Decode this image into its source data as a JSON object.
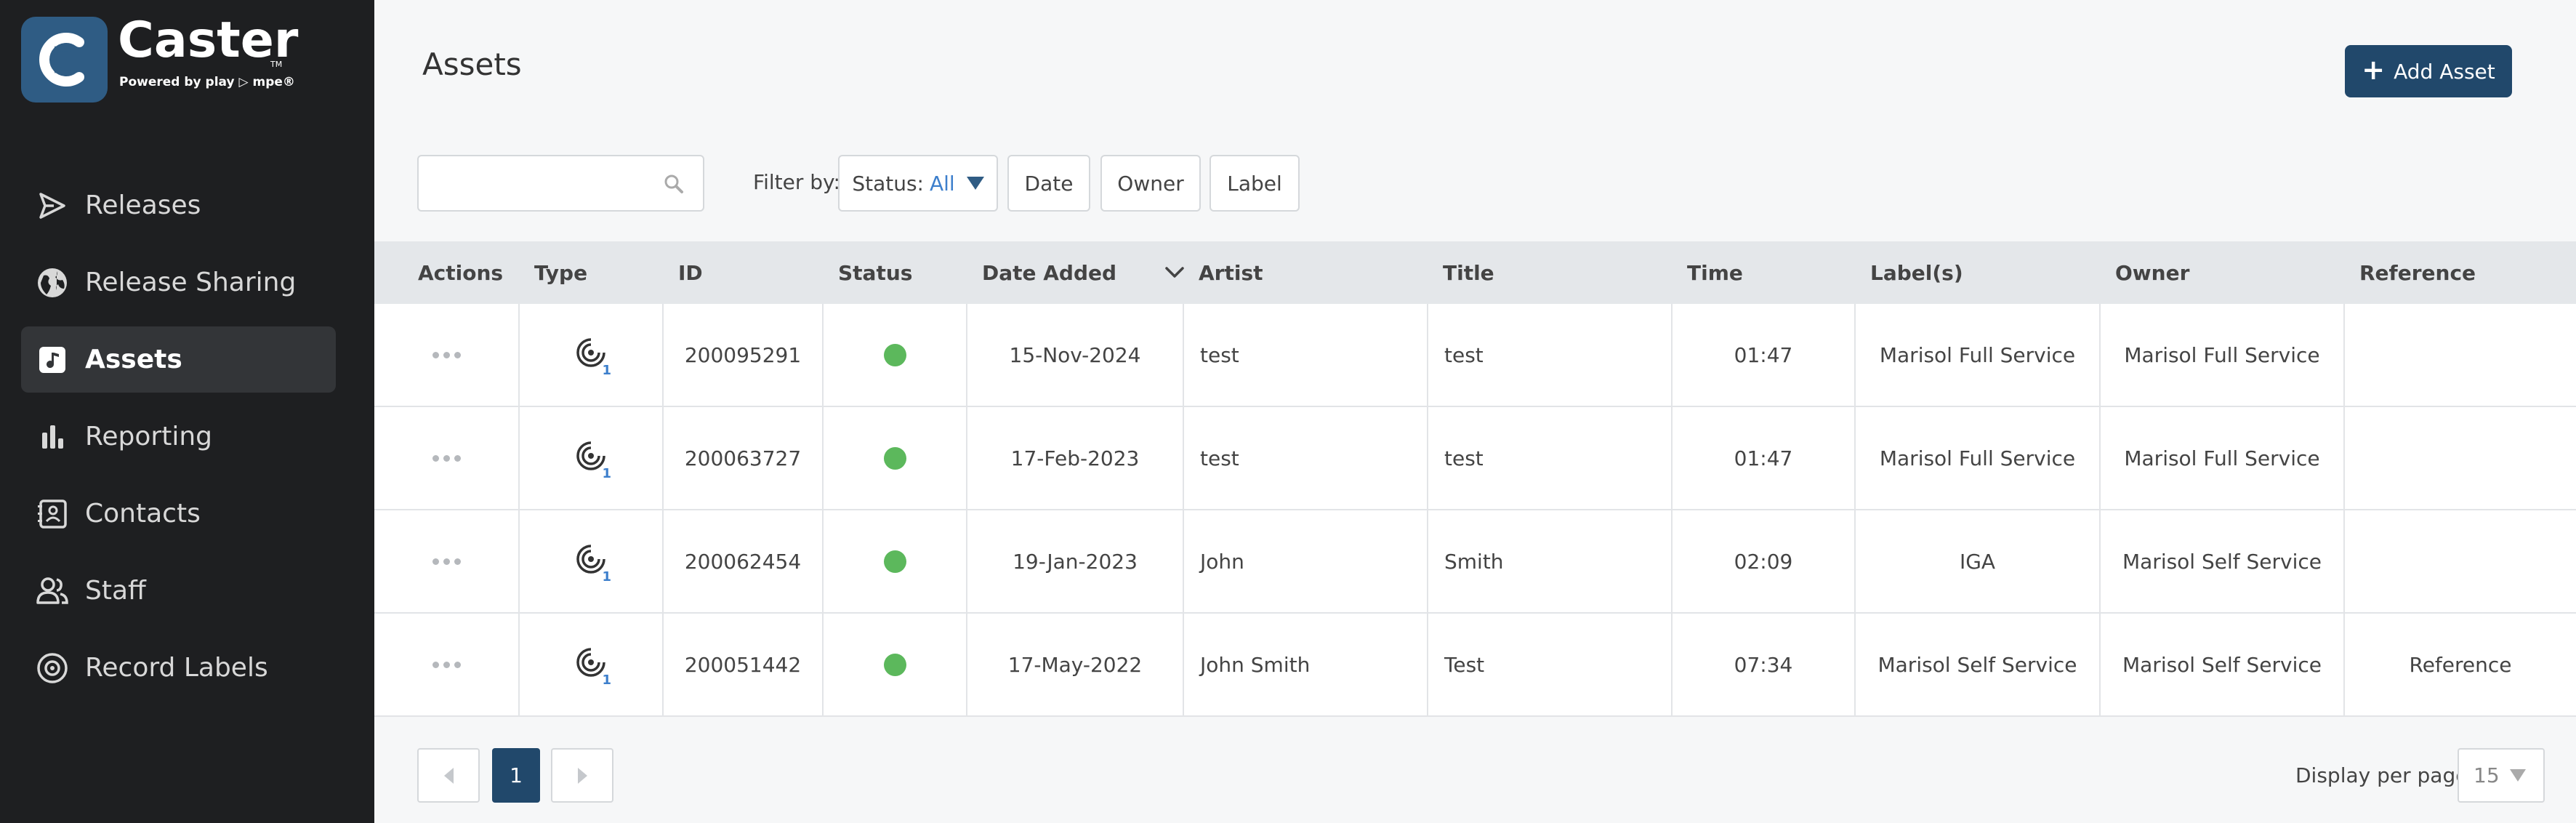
{
  "brand": {
    "name": "Caster",
    "tm": "TM",
    "tagline": "Powered by play ▷ mpe®"
  },
  "sidebar": {
    "items": [
      {
        "label": "Releases",
        "icon": "send-icon",
        "active": false
      },
      {
        "label": "Release Sharing",
        "icon": "globe-icon",
        "active": false
      },
      {
        "label": "Assets",
        "icon": "music-note-icon",
        "active": true
      },
      {
        "label": "Reporting",
        "icon": "bar-chart-icon",
        "active": false
      },
      {
        "label": "Contacts",
        "icon": "contact-card-icon",
        "active": false
      },
      {
        "label": "Staff",
        "icon": "users-icon",
        "active": false
      },
      {
        "label": "Record Labels",
        "icon": "record-icon",
        "active": false
      }
    ]
  },
  "page": {
    "title": "Assets",
    "add_button": "Add Asset"
  },
  "filters": {
    "search_placeholder": "",
    "label": "Filter by:",
    "status_label": "Status:",
    "status_value": "All",
    "date": "Date",
    "owner": "Owner",
    "label_btn": "Label"
  },
  "table": {
    "columns": [
      "Actions",
      "Type",
      "ID",
      "Status",
      "Date Added",
      "Artist",
      "Title",
      "Time",
      "Label(s)",
      "Owner",
      "Reference"
    ],
    "rows": [
      {
        "type_count": "1",
        "id": "200095291",
        "date": "15-Nov-2024",
        "artist": "test",
        "title": "test",
        "time": "01:47",
        "labels": "Marisol Full Service",
        "owner": "Marisol Full Service",
        "reference": ""
      },
      {
        "type_count": "1",
        "id": "200063727",
        "date": "17-Feb-2023",
        "artist": "test",
        "title": "test",
        "time": "01:47",
        "labels": "Marisol Full Service",
        "owner": "Marisol Full Service",
        "reference": ""
      },
      {
        "type_count": "1",
        "id": "200062454",
        "date": "19-Jan-2023",
        "artist": "John",
        "title": "Smith",
        "time": "02:09",
        "labels": "IGA",
        "owner": "Marisol Self Service",
        "reference": ""
      },
      {
        "type_count": "1",
        "id": "200051442",
        "date": "17-May-2022",
        "artist": "John Smith",
        "title": "Test",
        "time": "07:34",
        "labels": "Marisol Self Service",
        "owner": "Marisol Self Service",
        "reference": "Reference"
      }
    ]
  },
  "pagination": {
    "current_page": "1",
    "per_page_label": "Display per page",
    "per_page_value": "15"
  },
  "colors": {
    "sidebar_bg": "#1e1f21",
    "accent": "#21486b",
    "status_green": "#5cb85c"
  }
}
